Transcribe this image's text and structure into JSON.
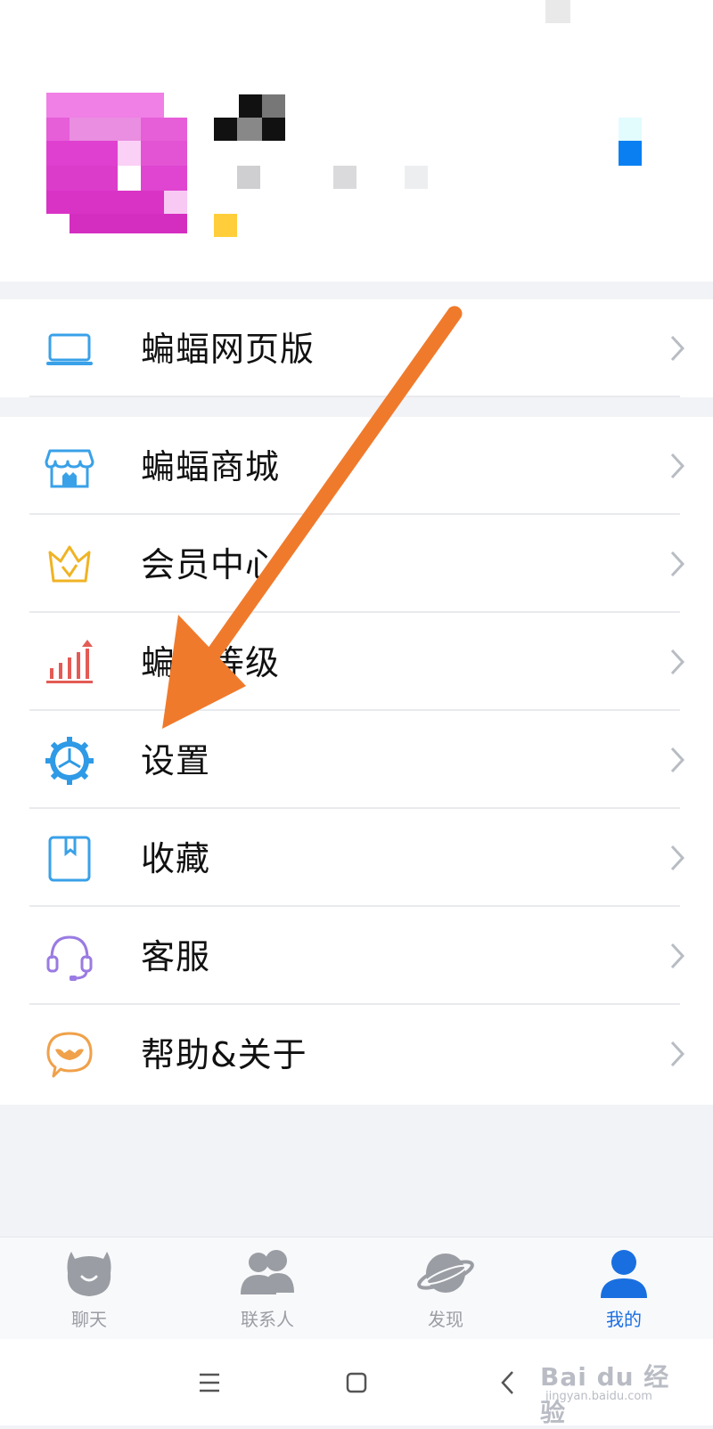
{
  "colors": {
    "accent": "#1a6fe0",
    "arrow": "#f07a2c",
    "chevron": "#b8bcc3",
    "tab_inactive": "#9a9da3"
  },
  "menu": {
    "group1": [
      {
        "label": "蝙蝠网页版",
        "icon": "laptop-icon"
      }
    ],
    "group2": [
      {
        "label": "蝙蝠商城",
        "icon": "store-icon"
      },
      {
        "label": "会员中心",
        "icon": "crown-icon"
      },
      {
        "label": "蝙蝠等级",
        "icon": "level-chart-icon"
      },
      {
        "label": "设置",
        "icon": "gear-icon"
      },
      {
        "label": "收藏",
        "icon": "bookmark-icon"
      },
      {
        "label": "客服",
        "icon": "headset-icon"
      },
      {
        "label": "帮助&关于",
        "icon": "bat-chat-icon"
      }
    ]
  },
  "tabs": [
    {
      "label": "聊天",
      "icon": "chat-bubble-icon",
      "active": false
    },
    {
      "label": "联系人",
      "icon": "contacts-icon",
      "active": false
    },
    {
      "label": "发现",
      "icon": "planet-icon",
      "active": false
    },
    {
      "label": "我的",
      "icon": "person-icon",
      "active": true
    }
  ],
  "system_nav": [
    "menu-icon",
    "home-icon",
    "back-icon"
  ],
  "watermark": {
    "brand": "Bai du 经验",
    "url": "jingyan.baidu.com"
  }
}
